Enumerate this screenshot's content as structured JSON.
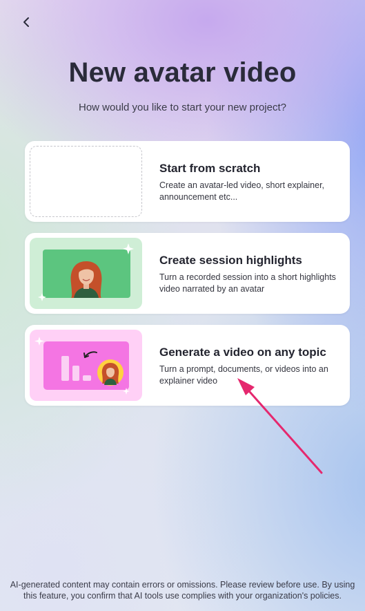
{
  "header": {
    "back_icon": "chevron-left-icon",
    "title": "New avatar video",
    "subtitle": "How would you like to start your new project?"
  },
  "options": [
    {
      "title": "Start from scratch",
      "description": "Create an avatar-led video, short explainer, announcement etc..."
    },
    {
      "title": "Create session highlights",
      "description": "Turn a recorded session into a short highlights video narrated by an avatar"
    },
    {
      "title": "Generate a video on any topic",
      "description": "Turn a prompt, documents, or videos into an explainer video"
    }
  ],
  "annotation": {
    "arrow_color": "#e5286e"
  },
  "footer": {
    "disclaimer": "AI-generated content may contain errors or omissions. Please review before use. By using this feature, you confirm that AI tools use complies with your organization's policies."
  },
  "colors": {
    "card_bg": "#ffffff",
    "green_thumb": "#cfeed6",
    "pink_thumb": "#ffd0f6"
  }
}
